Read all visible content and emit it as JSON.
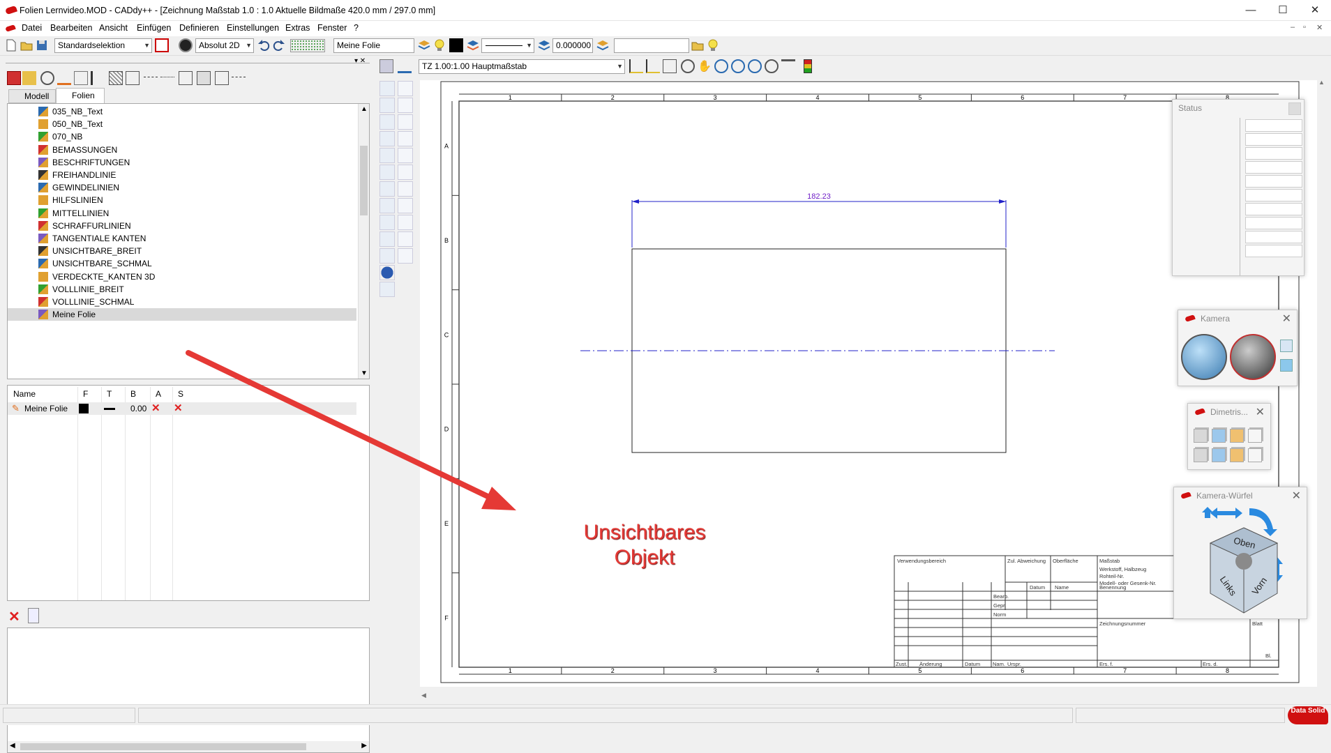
{
  "window": {
    "title": "Folien Lernvideo.MOD  -  CADdy++ - [Zeichnung   Maßstab 1.0 : 1.0   Aktuelle Bildmaße 420.0 mm / 297.0 mm]",
    "min": "—",
    "max": "☐",
    "close": "✕"
  },
  "menu": [
    "Datei",
    "Bearbeiten",
    "Ansicht",
    "Einfügen",
    "Definieren",
    "Einstellungen",
    "Extras",
    "Fenster",
    "?"
  ],
  "toolbar": {
    "selection": "Standardselektion",
    "coord_mode": "Absolut 2D",
    "layer_name": "Meine Folie",
    "line_width": "0.000000",
    "extra_field": ""
  },
  "left_tabs": [
    "Modell",
    "Folien"
  ],
  "layers": [
    "035_NB_Text",
    "050_NB_Text",
    "070_NB",
    "BEMASSUNGEN",
    "BESCHRIFTUNGEN",
    "FREIHANDLINIE",
    "GEWINDELINIEN",
    "HILFSLINIEN",
    "MITTELLINIEN",
    "SCHRAFFURLINIEN",
    "TANGENTIALE KANTEN",
    "UNSICHTBARE_BREIT",
    "UNSICHTBARE_SCHMAL",
    "VERDECKTE_KANTEN 3D",
    "VOLLLINIE_BREIT",
    "VOLLLINIE_SCHMAL",
    "Meine Folie"
  ],
  "selected_layer": "Meine Folie",
  "layer_grid": {
    "headers": [
      "Name",
      "F",
      "T",
      "B",
      "A",
      "S"
    ],
    "row": {
      "name": "Meine Folie",
      "width": "0.00"
    }
  },
  "view": {
    "scale_combo": "TZ 1.00:1.00 Hauptmaßstab"
  },
  "drawing": {
    "col_labels": [
      "1",
      "2",
      "3",
      "4",
      "5",
      "6",
      "7",
      "8"
    ],
    "row_labels": [
      "A",
      "B",
      "C",
      "D",
      "E",
      "F"
    ],
    "dimension": "182.23",
    "annotation_line1": "Unsichtbares",
    "annotation_line2": "Objekt",
    "titleblock": {
      "verwendung": "Verwendungsbereich",
      "zul": "Zul. Abweichung",
      "oberflaeche": "Oberfläche",
      "massstab": "Maßstab",
      "werkstoff": "Werkstoff, Halbzeug",
      "rohteil": "Rohteil-Nr.",
      "modell": "Modell- oder Gesenk-Nr.",
      "datum": "Datum",
      "name": "Name",
      "benennung": "Benennung",
      "bearb": "Bearb.",
      "gepr": "Gepr.",
      "norm": "Norm",
      "zeichnungsnummer": "Zeichnungsnummer",
      "blatt": "Blatt",
      "bl": "Bl.",
      "zust": "Zust.",
      "aenderung": "Änderung",
      "datum2": "Datum",
      "nam": "Nam.",
      "urspr": "Urspr.",
      "ers_f": "Ers. f.",
      "ers_d": "Ers. d."
    }
  },
  "floating": {
    "status": "Status",
    "kamera": "Kamera",
    "dimetrisch": "Dimetris...",
    "wuerfel": "Kamera-Würfel",
    "cube_top": "Oben",
    "cube_left": "Links",
    "cube_front": "Vorn"
  },
  "brand": "Data Solid",
  "colors": {
    "accent_red": "#e53935",
    "dim_blue": "#2020c8",
    "annotation": "#e53935"
  }
}
